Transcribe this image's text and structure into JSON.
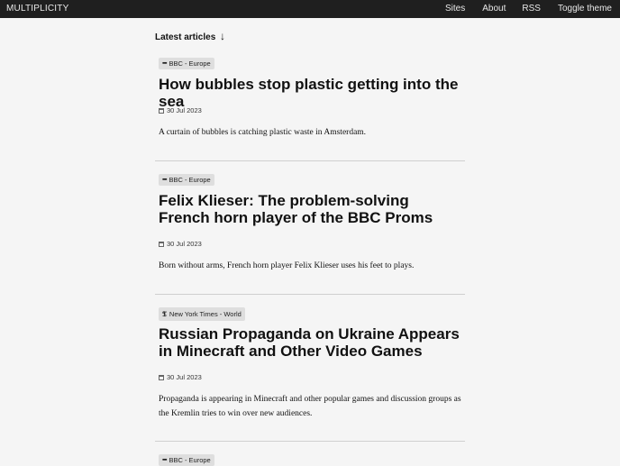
{
  "header": {
    "brand": "MULTIPLICITY",
    "nav": {
      "sites": "Sites",
      "about": "About",
      "rss": "RSS",
      "toggle_theme": "Toggle theme"
    }
  },
  "main": {
    "section_title": "Latest articles",
    "section_arrow": "↓",
    "articles": [
      {
        "source": "BBC - Europe",
        "source_icon": "bbc-icon",
        "title": "How bubbles stop plastic getting into the sea",
        "date": "30 Jul 2023",
        "summary": "A curtain of bubbles is catching plastic waste in Amsterdam."
      },
      {
        "source": "BBC - Europe",
        "source_icon": "bbc-icon",
        "title": "Felix Klieser: The problem-solving French horn player of the BBC Proms",
        "date": "30 Jul 2023",
        "summary": "Born without arms, French horn player Felix Klieser uses his feet to plays."
      },
      {
        "source": "New York Times - World",
        "source_icon": "nyt-icon",
        "title": "Russian Propaganda on Ukraine Appears in Minecraft and Other Video Games",
        "date": "30 Jul 2023",
        "summary": "Propaganda is appearing in Minecraft and other popular games and discussion groups as the Kremlin tries to win over new audiences."
      },
      {
        "source": "BBC - Europe",
        "source_icon": "bbc-icon"
      }
    ]
  }
}
